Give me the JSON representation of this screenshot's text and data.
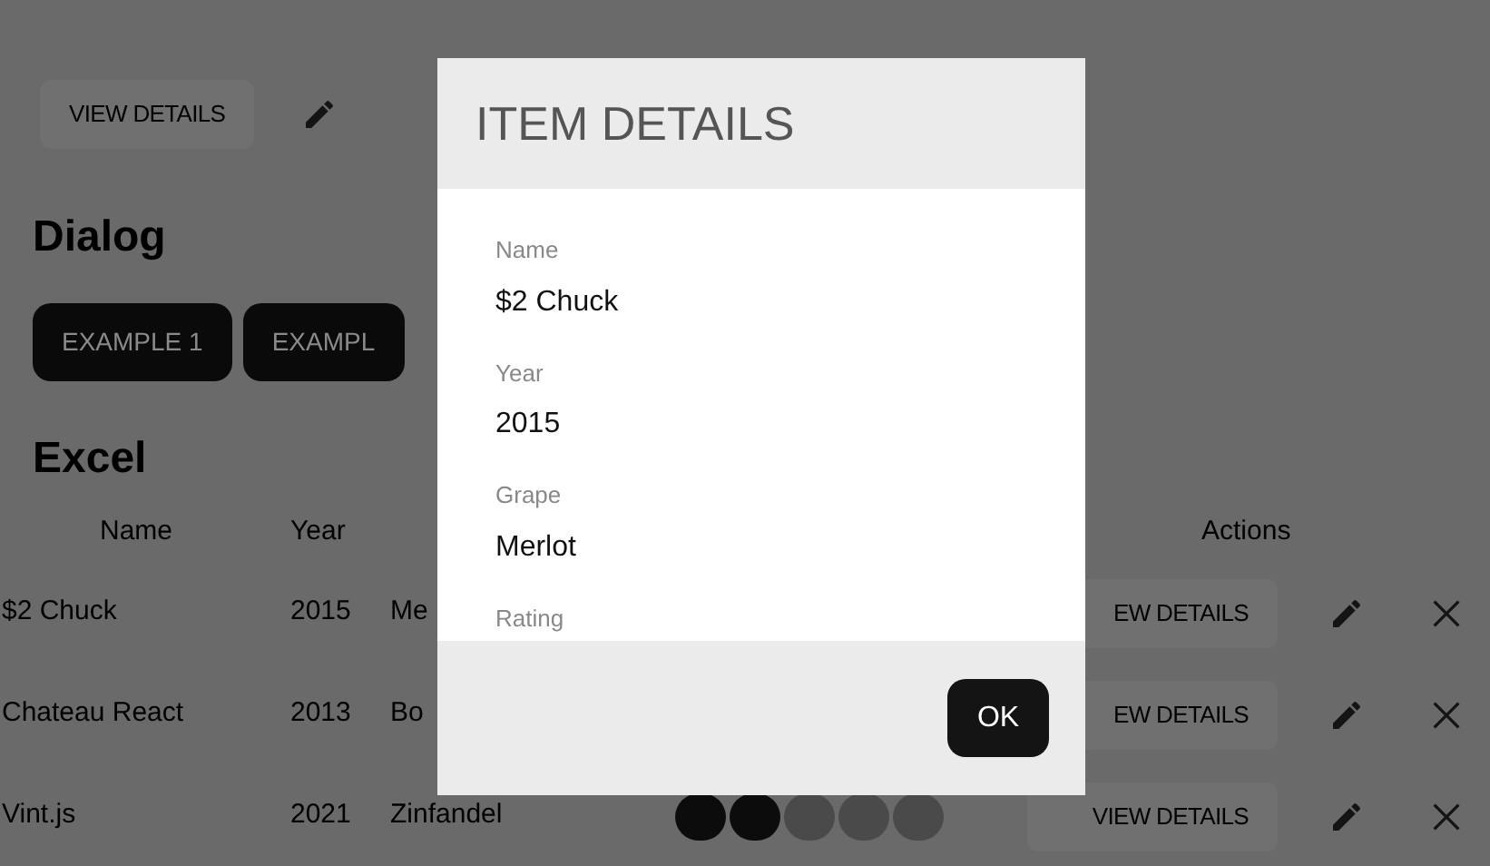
{
  "top_actions": {
    "view_button": "VIEW DETAILS"
  },
  "dialog_section": {
    "heading": "Dialog",
    "buttons": [
      "EXAMPLE 1",
      "EXAMPL"
    ]
  },
  "excel_section": {
    "heading": "Excel",
    "columns": [
      "Name",
      "Year",
      "Actions"
    ],
    "rows": [
      {
        "name": "$2 Chuck",
        "year": "2015",
        "grape": "Me",
        "view_button": "EW DETAILS"
      },
      {
        "name": "Chateau React",
        "year": "2013",
        "grape": "Bo",
        "view_button": "EW DETAILS"
      },
      {
        "name": "Vint.js",
        "year": "2021",
        "grape": "Zinfandel",
        "stars": 2,
        "view_button": "VIEW DETAILS"
      }
    ]
  },
  "modal": {
    "title": "ITEM DETAILS",
    "fields": [
      {
        "label": "Name",
        "value": "$2 Chuck"
      },
      {
        "label": "Year",
        "value": "2015"
      },
      {
        "label": "Grape",
        "value": "Merlot"
      }
    ],
    "cut_label": "Rating",
    "ok_button": "OK"
  }
}
